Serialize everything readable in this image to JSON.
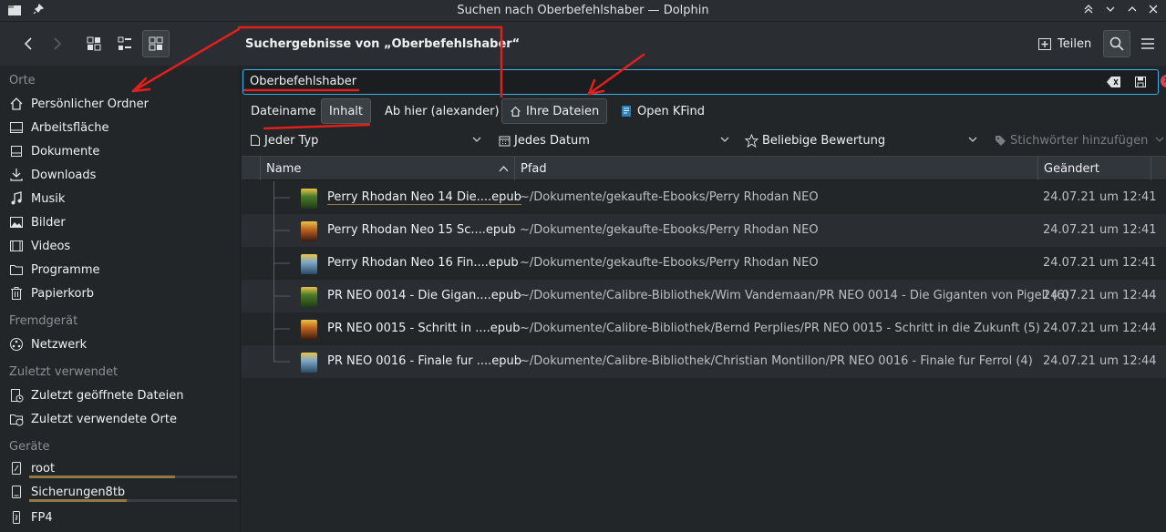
{
  "window": {
    "title": "Suchen nach Oberbefehlshaber — Dolphin"
  },
  "toolbar": {
    "breadcrumb": "Suchergebnisse von „Oberbefehlshaber“",
    "share_label": "Teilen"
  },
  "sidebar": {
    "sections": [
      {
        "title": "Orte",
        "items": [
          "Persönlicher Ordner",
          "Arbeitsfläche",
          "Dokumente",
          "Downloads",
          "Musik",
          "Bilder",
          "Videos",
          "Programme",
          "Papierkorb"
        ]
      },
      {
        "title": "Fremdgerät",
        "items": [
          "Netzwerk"
        ]
      },
      {
        "title": "Zuletzt verwendet",
        "items": [
          "Zuletzt geöffnete Dateien",
          "Zuletzt verwendete Orte"
        ]
      },
      {
        "title": "Geräte",
        "items": [
          "root",
          "Sicherungen8tb",
          "FP4"
        ]
      }
    ],
    "device_usage": {
      "root": 0.7,
      "Sicherungen8tb": 0.47
    }
  },
  "search": {
    "query": "Oberbefehlshaber",
    "opt_filename": "Dateiname",
    "opt_content": "Inhalt",
    "opt_from_here": "Ab hier (alexander)",
    "opt_your_files": "Ihre Dateien",
    "opt_kfind": "Open KFind",
    "filter_type": "Jeder Typ",
    "filter_date": "Jedes Datum",
    "filter_rating": "Beliebige Bewertung",
    "filter_tags": "Stichwörter hinzufügen"
  },
  "table": {
    "columns": [
      "Name",
      "Pfad",
      "Geändert"
    ],
    "rows": [
      {
        "name": "Perry Rhodan Neo 14 Die....epub",
        "path": "~/Dokumente/gekaufte-Ebooks/Perry Rhodan NEO",
        "date": "24.07.21 um 12:41"
      },
      {
        "name": "Perry Rhodan Neo 15 Sc....epub",
        "path": "~/Dokumente/gekaufte-Ebooks/Perry Rhodan NEO",
        "date": "24.07.21 um 12:41"
      },
      {
        "name": "Perry Rhodan Neo 16 Fin....epub",
        "path": "~/Dokumente/gekaufte-Ebooks/Perry Rhodan NEO",
        "date": "24.07.21 um 12:41"
      },
      {
        "name": "PR NEO 0014 - Die Gigan....epub",
        "path": "~/Dokumente/Calibre-Bibliothek/Wim Vandemaan/PR NEO 0014 - Die Giganten von Pigell (6)",
        "date": "24.07.21 um 12:44"
      },
      {
        "name": "PR NEO 0015 - Schritt in ....epub",
        "path": "~/Dokumente/Calibre-Bibliothek/Bernd Perplies/PR NEO 0015 - Schritt in die Zukunft (5)",
        "date": "24.07.21 um 12:44"
      },
      {
        "name": "PR NEO 0016 - Finale fur ....epub",
        "path": "~/Dokumente/Calibre-Bibliothek/Christian Montillon/PR NEO 0016 - Finale fur Ferrol (4)",
        "date": "24.07.21 um 12:44"
      }
    ]
  },
  "colors": {
    "accent": "#3daee9",
    "annotation": "#e0201c",
    "background": "#232629"
  }
}
